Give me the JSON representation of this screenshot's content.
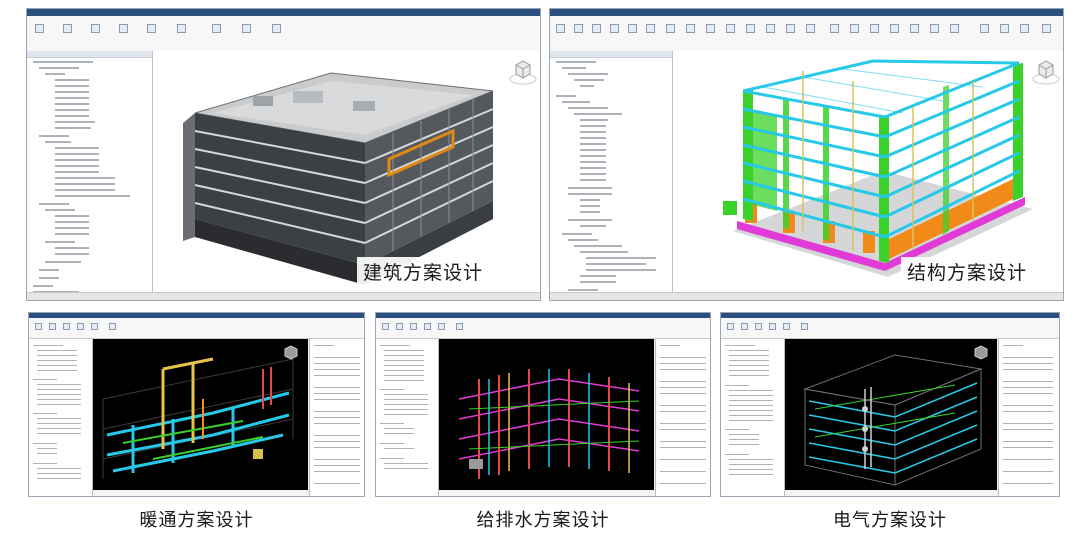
{
  "panels": [
    {
      "label": "建筑方案设计"
    },
    {
      "label": "结构方案设计"
    },
    {
      "label": "暖通方案设计"
    },
    {
      "label": "给排水方案设计"
    },
    {
      "label": "电气方案设计"
    }
  ],
  "colors": {
    "title_bar": "#2b4f7e",
    "viewport_light": "#ffffff",
    "viewport_dark": "#000000",
    "structure_green": "#39d12a",
    "structure_cyan": "#27c8e8",
    "structure_orange": "#f28a1a",
    "structure_magenta": "#e23ad6",
    "architecture_highlight": "#e08a12"
  },
  "icons": [
    "view-cube-icon"
  ]
}
